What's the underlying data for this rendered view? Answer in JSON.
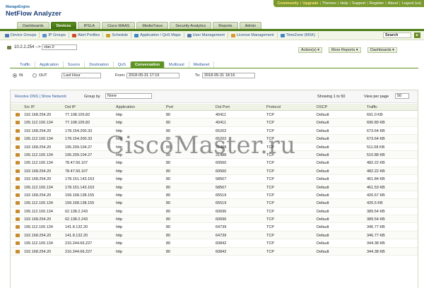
{
  "brand": {
    "vendor": "ManageEngine",
    "product": "NetFlow Analyzer"
  },
  "top_links": [
    {
      "label": "Community",
      "highlight": true
    },
    {
      "label": "Upgrade",
      "highlight": true
    },
    {
      "label": "Themes",
      "highlight": false
    },
    {
      "label": "Help",
      "highlight": false
    },
    {
      "label": "Support",
      "highlight": false
    },
    {
      "label": "Register",
      "highlight": false
    },
    {
      "label": "About",
      "highlight": false
    },
    {
      "label": "Logout (vs)",
      "highlight": false
    }
  ],
  "main_tabs": [
    {
      "label": "Dashboards",
      "active": false
    },
    {
      "label": "Devices",
      "active": true
    },
    {
      "label": "IPSLA",
      "active": false
    },
    {
      "label": "Cisco WAAS",
      "active": false
    },
    {
      "label": "MediaTrace",
      "active": false
    },
    {
      "label": "Security Analytics",
      "active": false
    },
    {
      "label": "Reports",
      "active": false
    },
    {
      "label": "Admin",
      "active": false
    }
  ],
  "subnav": [
    {
      "label": "Device Groups",
      "icon": "device-groups-icon",
      "color": "#4a78b8"
    },
    {
      "label": "IP Groups",
      "icon": "ip-groups-icon",
      "color": "#5b8fcf"
    },
    {
      "label": "Alert Profiles",
      "icon": "alert-icon",
      "color": "#d04a2a"
    },
    {
      "label": "Schedule",
      "icon": "schedule-icon",
      "color": "#c9a227"
    },
    {
      "label": "Application / QoS Maps",
      "icon": "app-map-icon",
      "color": "#3a86c8"
    },
    {
      "label": "User Management",
      "icon": "user-icon",
      "color": "#5678a8"
    },
    {
      "label": "License Management",
      "icon": "license-icon",
      "color": "#d89a2c"
    },
    {
      "label": "TimeZone (MSK)",
      "icon": "clock-icon",
      "color": "#3f86c9"
    }
  ],
  "search": {
    "value": "Search",
    "go": "►"
  },
  "device": {
    "ip": "10.2.2.254 -->",
    "interface": "vlan.0"
  },
  "device_actions": [
    "Action(s) ▾",
    "More Reports ▾",
    "Dashboards ▾"
  ],
  "content_tabs": [
    {
      "label": "Traffic",
      "active": false
    },
    {
      "label": "Application",
      "active": false
    },
    {
      "label": "Source",
      "active": false
    },
    {
      "label": "Destination",
      "active": false
    },
    {
      "label": "QoS",
      "active": false
    },
    {
      "label": "Conversation",
      "active": true
    },
    {
      "label": "Multicast",
      "active": false
    },
    {
      "label": "Medianet",
      "active": false
    }
  ],
  "filter": {
    "in_label": "IN",
    "out_label": "OUT",
    "period": "Last Hour",
    "from_label": "From:",
    "from_value": "2018-05-31 17:16",
    "to_label": "To:",
    "to_value": "2018-05-31 18:16"
  },
  "table_toolbar": {
    "resolve_dns": "Resolve DNS",
    "show_network": "Show Network",
    "group_by_label": "Group by",
    "group_by_value": "None",
    "showing": "Showing 1 to 50",
    "per_page_label": "View per page",
    "per_page_value": "50"
  },
  "table": {
    "columns": [
      "Src IP",
      "Dst IP",
      "Application",
      "Port",
      "Dst Port",
      "Protocol",
      "DSCP",
      "Traffic"
    ],
    "rows": [
      [
        "192.168.254.20",
        "77.108.105.82",
        "http",
        "80",
        "40411",
        "TCP",
        "Default",
        "691.0 KB"
      ],
      [
        "195.112.100.134",
        "77.108.105.82",
        "http",
        "80",
        "40411",
        "TCP",
        "Default",
        "690.89 KB"
      ],
      [
        "192.168.254.20",
        "178.154.200.33",
        "http",
        "80",
        "65202",
        "TCP",
        "Default",
        "673.64 KB"
      ],
      [
        "195.112.100.134",
        "178.154.200.33",
        "http",
        "80",
        "65202",
        "TCP",
        "Default",
        "673.64 KB"
      ],
      [
        "192.168.254.20",
        "195.209.104.27",
        "http",
        "80",
        "31488",
        "TCP",
        "Default",
        "511.08 KB"
      ],
      [
        "195.112.100.134",
        "195.209.104.27",
        "http",
        "80",
        "31488",
        "TCP",
        "Default",
        "510.88 KB"
      ],
      [
        "195.112.100.134",
        "78.47.56.107",
        "http",
        "80",
        "60560",
        "TCP",
        "Default",
        "482.22 KB"
      ],
      [
        "192.168.254.20",
        "78.47.56.107",
        "http",
        "80",
        "60560",
        "TCP",
        "Default",
        "482.22 KB"
      ],
      [
        "192.168.254.20",
        "178.151.143.163",
        "http",
        "80",
        "58567",
        "TCP",
        "Default",
        "461.84 KB"
      ],
      [
        "195.112.100.134",
        "178.151.143.163",
        "http",
        "80",
        "58567",
        "TCP",
        "Default",
        "461.53 KB"
      ],
      [
        "192.168.254.20",
        "199.168.138.155",
        "http",
        "80",
        "65519",
        "TCP",
        "Default",
        "426.67 KB"
      ],
      [
        "195.112.100.134",
        "199.168.138.155",
        "http",
        "80",
        "65519",
        "TCP",
        "Default",
        "426.5 KB"
      ],
      [
        "195.112.100.134",
        "62.138.2.243",
        "http",
        "80",
        "60696",
        "TCP",
        "Default",
        "389.54 KB"
      ],
      [
        "192.168.254.20",
        "62.138.2.243",
        "http",
        "80",
        "60696",
        "TCP",
        "Default",
        "389.54 KB"
      ],
      [
        "195.112.100.134",
        "141.8.132.20",
        "http",
        "80",
        "64739",
        "TCP",
        "Default",
        "346.77 KB"
      ],
      [
        "192.168.254.20",
        "141.8.132.20",
        "http",
        "80",
        "64739",
        "TCP",
        "Default",
        "346.77 KB"
      ],
      [
        "195.112.100.134",
        "216.244.66.227",
        "http",
        "80",
        "60842",
        "TCP",
        "Default",
        "344.38 KB"
      ],
      [
        "192.168.254.20",
        "216.244.66.227",
        "http",
        "80",
        "60842",
        "TCP",
        "Default",
        "344.38 KB"
      ]
    ]
  },
  "watermark": "CiscoMaster.ru"
}
